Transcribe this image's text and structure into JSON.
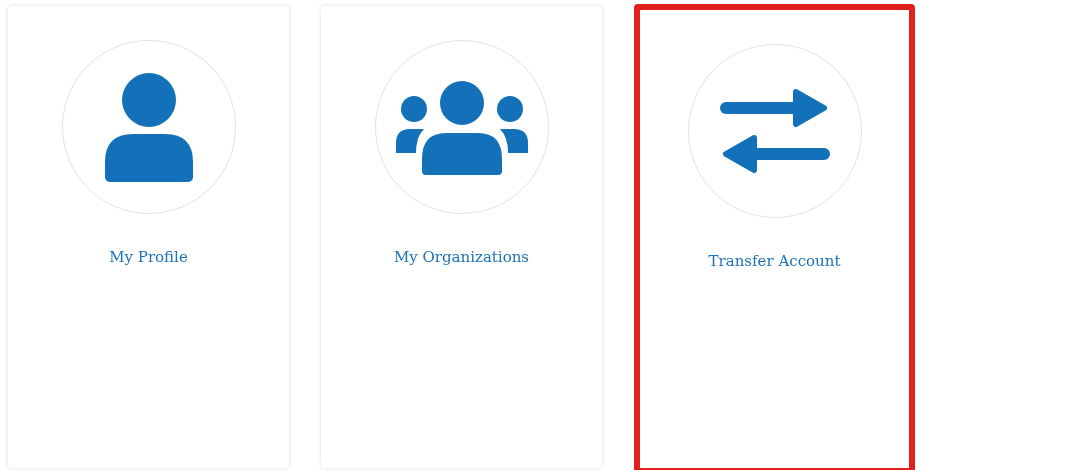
{
  "cards": [
    {
      "label": "My Profile",
      "highlighted": false
    },
    {
      "label": "My Organizations",
      "highlighted": false
    },
    {
      "label": "Transfer Account",
      "highlighted": true
    }
  ]
}
